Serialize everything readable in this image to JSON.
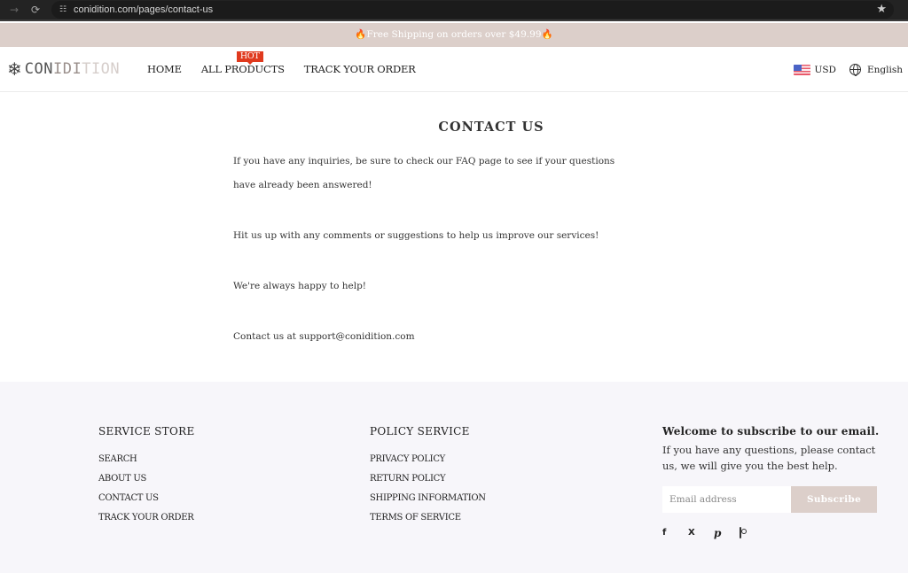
{
  "browser": {
    "forward_icon": "→",
    "reload_icon": "⟳",
    "site_info_icon": "☷",
    "url": "conidition.com/pages/contact-us",
    "bookmark_icon": "★"
  },
  "announcement": {
    "text": "🔥Free Shipping on orders over $49.99🔥"
  },
  "header": {
    "logo": {
      "mark": "❄",
      "part1": "CON",
      "part2": "IDI",
      "part3": "TION"
    },
    "nav": [
      {
        "label": "HOME"
      },
      {
        "label": "ALL PRODUCTS",
        "badge": "HOT"
      },
      {
        "label": "TRACK YOUR ORDER"
      }
    ],
    "currency": "USD",
    "language": "English"
  },
  "main": {
    "title": "CONTACT US",
    "paragraphs": [
      "If you have any inquiries, be sure to check our FAQ page to see if your questions",
      "have already been answered!",
      "Hit us up with any comments or suggestions to help us improve our services!",
      "We're always happy to help!",
      "Contact us at support@conidition.com"
    ]
  },
  "footer": {
    "service_store": {
      "title": "SERVICE STORE",
      "links": [
        "SEARCH",
        "ABOUT US",
        "CONTACT US",
        "TRACK YOUR ORDER"
      ]
    },
    "policy_service": {
      "title": "POLICY SERVICE",
      "links": [
        "PRIVACY POLICY",
        "RETURN POLICY",
        "SHIPPING INFORMATION",
        "TERMS OF SERVICE"
      ]
    },
    "newsletter": {
      "title": "Welcome to subscribe to our email.",
      "text": "If you have any questions, please contact us, we will give you the best help.",
      "email_placeholder": "Email address",
      "email_value": "",
      "subscribe_label": "Subscribe"
    },
    "socials": [
      {
        "name": "facebook",
        "glyph": "f"
      },
      {
        "name": "x-twitter",
        "glyph": "X"
      },
      {
        "name": "pinterest",
        "glyph": "P"
      },
      {
        "name": "instagram",
        "glyph": ""
      }
    ]
  },
  "colors": {
    "announcement_bg": "#dccfca",
    "hot_badge": "#e03a1e",
    "footer_bg": "#f7f6fa",
    "subscribe_bg": "#dccfca"
  }
}
